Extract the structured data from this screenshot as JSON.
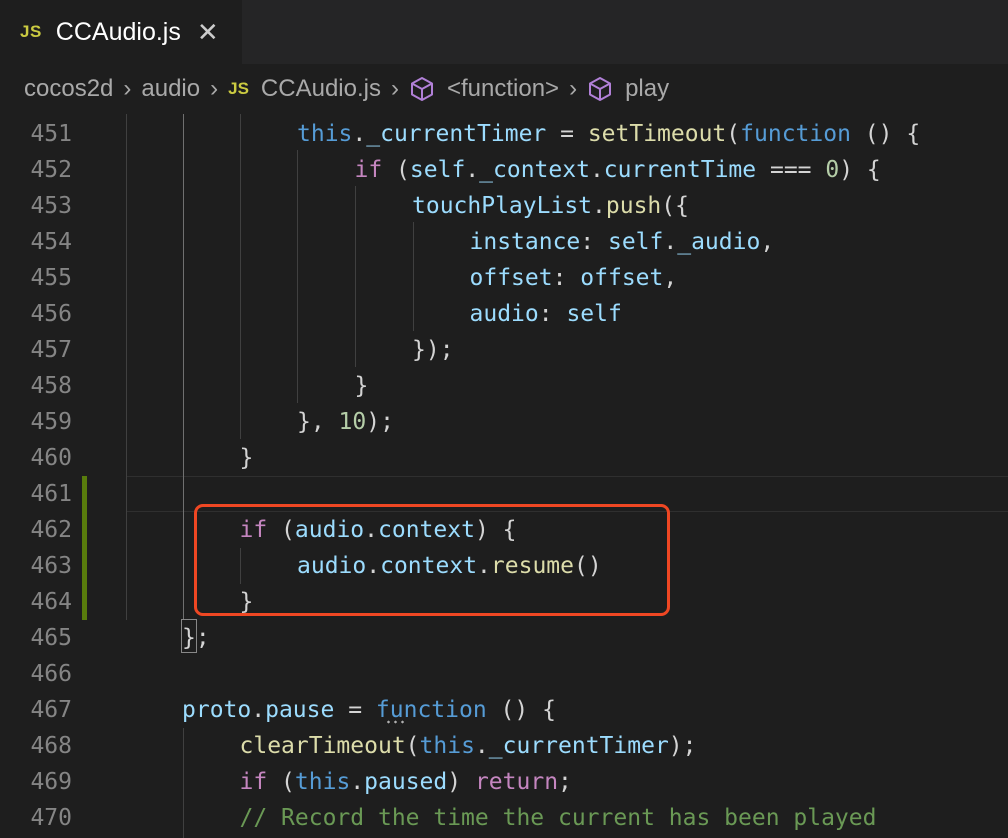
{
  "tab": {
    "badge": "JS",
    "title": "CCAudio.js",
    "close": "✕"
  },
  "breadcrumb": {
    "items": [
      "cocos2d",
      "audio",
      "CCAudio.js",
      "<function>",
      "play"
    ],
    "file_badge": "JS",
    "separator": "›"
  },
  "icons": {
    "file_type": "js-file-icon",
    "symbol": "cube-icon",
    "close": "close-icon"
  },
  "colors": {
    "highlight_box": "#ef4723",
    "modified_gutter": "#587c0c",
    "keyword": "#569cd6",
    "control": "#c586c0",
    "function": "#dcdcaa",
    "variable": "#9cdcfe",
    "number": "#b5cea8",
    "comment": "#6a9955"
  },
  "editor": {
    "lines": [
      {
        "n": "451",
        "indent": 2,
        "tokens": [
          [
            "kw",
            "this"
          ],
          [
            "pun",
            "."
          ],
          [
            "var",
            "_currentTimer"
          ],
          [
            "pun",
            " = "
          ],
          [
            "fn",
            "setTimeout"
          ],
          [
            "pun",
            "("
          ],
          [
            "kw",
            "function"
          ],
          [
            "pun",
            " () {"
          ]
        ]
      },
      {
        "n": "452",
        "indent": 3,
        "tokens": [
          [
            "ctl",
            "if"
          ],
          [
            "pun",
            " ("
          ],
          [
            "var",
            "self"
          ],
          [
            "pun",
            "."
          ],
          [
            "var",
            "_context"
          ],
          [
            "pun",
            "."
          ],
          [
            "var",
            "currentTime"
          ],
          [
            "pun",
            " === "
          ],
          [
            "num",
            "0"
          ],
          [
            "pun",
            ") {"
          ]
        ]
      },
      {
        "n": "453",
        "indent": 4,
        "tokens": [
          [
            "var",
            "touchPlayList"
          ],
          [
            "pun",
            "."
          ],
          [
            "fn",
            "push"
          ],
          [
            "pun",
            "({"
          ]
        ]
      },
      {
        "n": "454",
        "indent": 5,
        "tokens": [
          [
            "var",
            "instance"
          ],
          [
            "pun",
            ": "
          ],
          [
            "var",
            "self"
          ],
          [
            "pun",
            "."
          ],
          [
            "var",
            "_audio"
          ],
          [
            "pun",
            ","
          ]
        ]
      },
      {
        "n": "455",
        "indent": 5,
        "tokens": [
          [
            "var",
            "offset"
          ],
          [
            "pun",
            ": "
          ],
          [
            "var",
            "offset"
          ],
          [
            "pun",
            ","
          ]
        ]
      },
      {
        "n": "456",
        "indent": 5,
        "tokens": [
          [
            "var",
            "audio"
          ],
          [
            "pun",
            ": "
          ],
          [
            "var",
            "self"
          ]
        ]
      },
      {
        "n": "457",
        "indent": 4,
        "tokens": [
          [
            "pun",
            "});"
          ]
        ]
      },
      {
        "n": "458",
        "indent": 3,
        "tokens": [
          [
            "pun",
            "}"
          ]
        ]
      },
      {
        "n": "459",
        "indent": 2,
        "tokens": [
          [
            "pun",
            "}, "
          ],
          [
            "num",
            "10"
          ],
          [
            "pun",
            ");"
          ]
        ]
      },
      {
        "n": "460",
        "indent": 1,
        "tokens": [
          [
            "pun",
            "}"
          ]
        ]
      },
      {
        "n": "461",
        "indent": 0,
        "tokens": []
      },
      {
        "n": "462",
        "indent": 1,
        "tokens": [
          [
            "ctl",
            "if"
          ],
          [
            "pun",
            " ("
          ],
          [
            "var",
            "audio"
          ],
          [
            "pun",
            "."
          ],
          [
            "var",
            "context"
          ],
          [
            "pun",
            ") {"
          ]
        ]
      },
      {
        "n": "463",
        "indent": 2,
        "tokens": [
          [
            "var",
            "audio"
          ],
          [
            "pun",
            "."
          ],
          [
            "var",
            "context"
          ],
          [
            "pun",
            "."
          ],
          [
            "fn",
            "resume"
          ],
          [
            "pun",
            "()"
          ]
        ]
      },
      {
        "n": "464",
        "indent": 1,
        "tokens": [
          [
            "pun",
            "}"
          ]
        ]
      },
      {
        "n": "465",
        "indent": 0,
        "tokens": [
          [
            "pun",
            "};"
          ]
        ]
      },
      {
        "n": "466",
        "indent": 0,
        "tokens": []
      },
      {
        "n": "467",
        "indent": 0,
        "tokens": [
          [
            "var",
            "proto"
          ],
          [
            "pun",
            "."
          ],
          [
            "var",
            "pause"
          ],
          [
            "pun",
            " = "
          ],
          [
            "kw",
            "function"
          ],
          [
            "pun",
            " () {"
          ]
        ]
      },
      {
        "n": "468",
        "indent": 1,
        "tokens": [
          [
            "fn",
            "clearTimeout"
          ],
          [
            "pun",
            "("
          ],
          [
            "kw",
            "this"
          ],
          [
            "pun",
            "."
          ],
          [
            "var",
            "_currentTimer"
          ],
          [
            "pun",
            ");"
          ]
        ]
      },
      {
        "n": "469",
        "indent": 1,
        "tokens": [
          [
            "ctl",
            "if"
          ],
          [
            "pun",
            " ("
          ],
          [
            "kw",
            "this"
          ],
          [
            "pun",
            "."
          ],
          [
            "var",
            "paused"
          ],
          [
            "pun",
            ") "
          ],
          [
            "ctl",
            "return"
          ],
          [
            "pun",
            ";"
          ]
        ]
      },
      {
        "n": "470",
        "indent": 1,
        "tokens": [
          [
            "cmt",
            "// Record the time the current has been played"
          ]
        ]
      }
    ]
  }
}
